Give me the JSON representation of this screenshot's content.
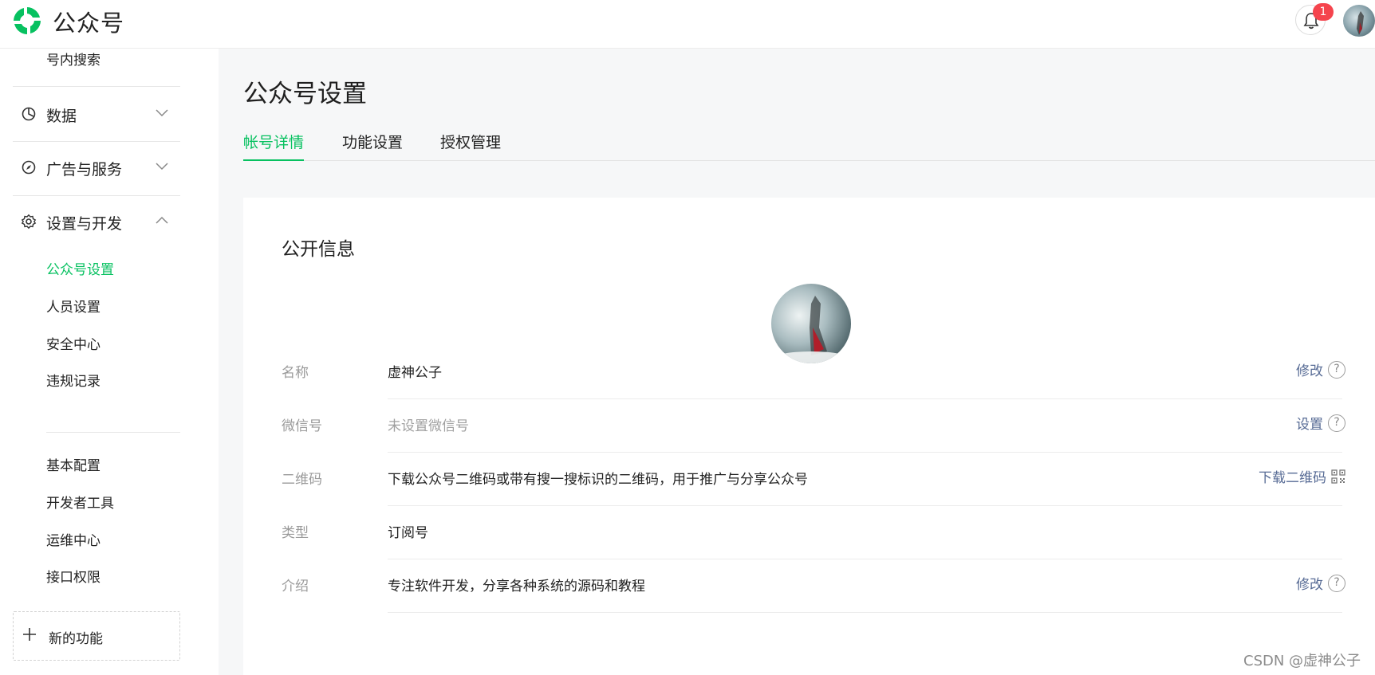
{
  "header": {
    "app_name": "公众号",
    "notification_count": "1",
    "brand_color": "#07c160",
    "badge_color": "#f5444d"
  },
  "sidebar": {
    "top_item": "号内搜索",
    "groups": [
      {
        "label": "数据",
        "icon": "pie-chart-icon",
        "expanded": false
      },
      {
        "label": "广告与服务",
        "icon": "compass-icon",
        "expanded": false
      },
      {
        "label": "设置与开发",
        "icon": "gear-icon",
        "expanded": true
      }
    ],
    "settings_items": [
      "公众号设置",
      "人员设置",
      "安全中心",
      "违规记录"
    ],
    "dev_items": [
      "基本配置",
      "开发者工具",
      "运维中心",
      "接口权限"
    ],
    "active_item": "公众号设置",
    "new_feature": "新的功能"
  },
  "main": {
    "title": "公众号设置",
    "tabs": [
      {
        "label": "帐号详情",
        "active": true
      },
      {
        "label": "功能设置",
        "active": false
      },
      {
        "label": "授权管理",
        "active": false
      }
    ],
    "section_title": "公开信息",
    "rows": [
      {
        "label": "名称",
        "value": "虚神公子",
        "action": "修改",
        "action_icon": "help-icon"
      },
      {
        "label": "微信号",
        "value": "未设置微信号",
        "action": "设置",
        "action_icon": "help-icon"
      },
      {
        "label": "二维码",
        "value": "下载公众号二维码或带有搜一搜标识的二维码，用于推广与分享公众号",
        "action": "下载二维码",
        "action_icon": "qrcode-icon"
      },
      {
        "label": "类型",
        "value": "订阅号",
        "action": "",
        "action_icon": ""
      },
      {
        "label": "介绍",
        "value": "专注软件开发，分享各种系统的源码和教程",
        "action": "修改",
        "action_icon": "help-icon"
      }
    ]
  },
  "watermark": "CSDN @虚神公子"
}
